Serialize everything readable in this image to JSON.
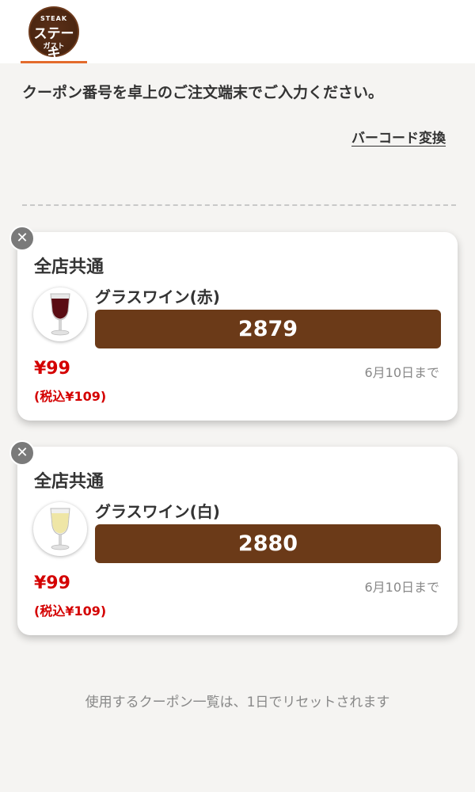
{
  "header": {
    "logo": {
      "line1": "STEAK",
      "line2": "ステーキ",
      "line3": "ガスト"
    }
  },
  "instruction": "クーポン番号を卓上のご注文端末でご入力ください。",
  "barcode_link": "バーコード変換",
  "coupons": [
    {
      "store": "全店共通",
      "item": "グラスワイン(赤)",
      "code": "2879",
      "price": "¥99",
      "price_tax": "(税込¥109)",
      "expiry": "6月10日まで",
      "wine_color": "#5a0d14"
    },
    {
      "store": "全店共通",
      "item": "グラスワイン(白)",
      "code": "2880",
      "price": "¥99",
      "price_tax": "(税込¥109)",
      "expiry": "6月10日まで",
      "wine_color": "#efe6a6"
    }
  ],
  "footer_note": "使用するクーポン一覧は、1日でリセットされます",
  "colors": {
    "accent": "#e36b2c",
    "code_bg": "#6b3a18",
    "price": "#d40000",
    "close_bg": "#7a7a7a"
  }
}
